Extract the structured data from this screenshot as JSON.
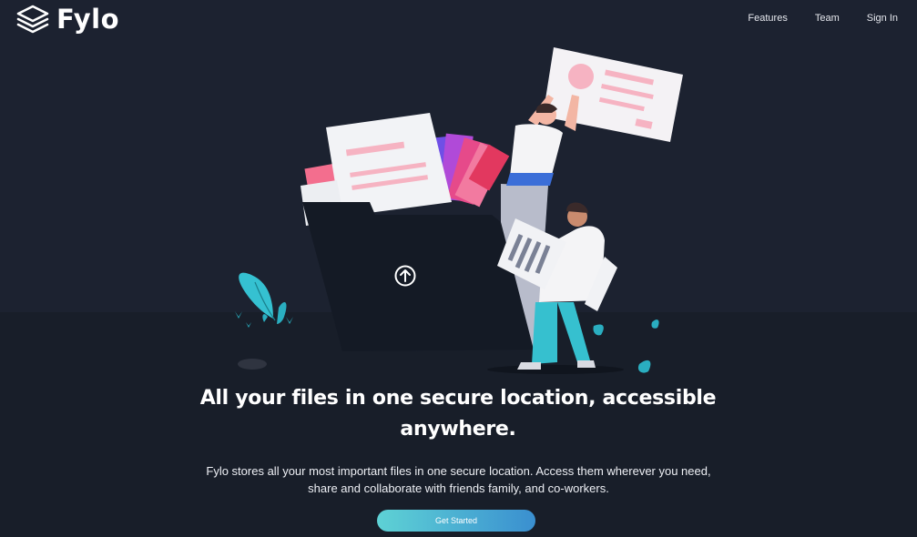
{
  "brand": {
    "name": "Fylo",
    "icon": "layers-icon"
  },
  "nav": {
    "items": [
      {
        "label": "Features"
      },
      {
        "label": "Team"
      },
      {
        "label": "Sign In"
      }
    ]
  },
  "hero": {
    "illustration": "people-moving-files-into-folder",
    "upload_icon": "upload-arrow-icon",
    "headline": "All your files in one secure location, accessible anywhere.",
    "subtext": "Fylo stores all your most important files in one secure location. Access them wherever you need, share and collaborate with friends family, and co-workers.",
    "cta_label": "Get Started"
  },
  "colors": {
    "background": "#1c2230",
    "background_lower": "#181e29",
    "folder": "#141a25",
    "cta_gradient_start": "#5ed2d5",
    "cta_gradient_end": "#3a8fd0",
    "accent_pink": "#f7a8b8",
    "accent_cyan": "#3fc5d0"
  }
}
